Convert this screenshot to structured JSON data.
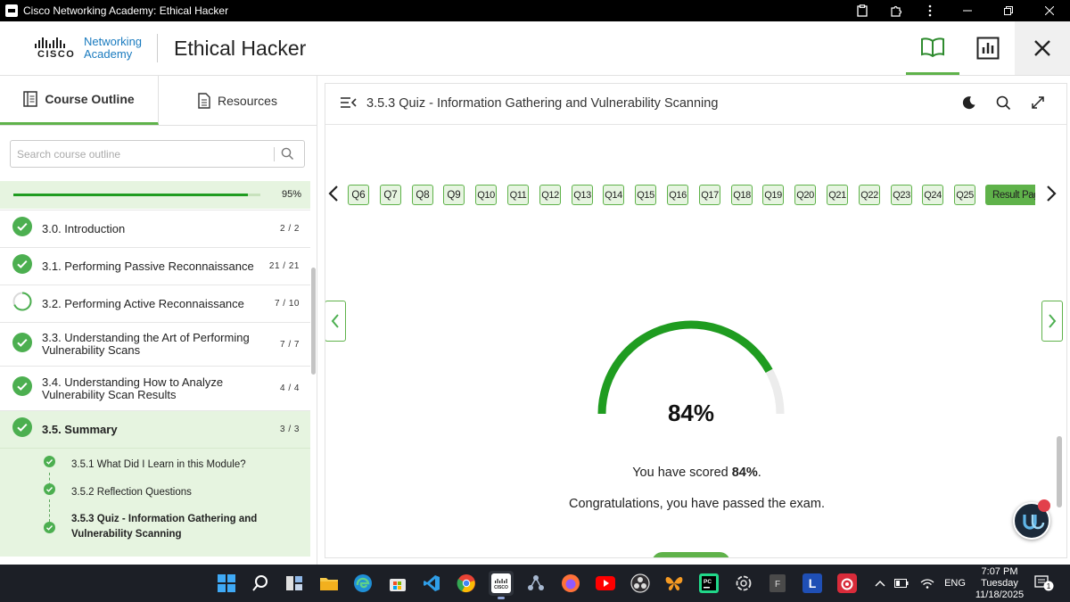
{
  "window": {
    "title": "Cisco Networking Academy: Ethical Hacker"
  },
  "header": {
    "logo_word": "CISCO",
    "logo_line1": "Networking",
    "logo_line2": "Academy",
    "course_title": "Ethical Hacker"
  },
  "sidebar": {
    "tabs": [
      {
        "label": "Course Outline",
        "icon": "outline-icon",
        "active": true
      },
      {
        "label": "Resources",
        "icon": "document-icon",
        "active": false
      }
    ],
    "search_placeholder": "Search course outline",
    "progress": {
      "percent_label": "95%",
      "percent": 95
    },
    "modules": [
      {
        "label": "3.0. Introduction",
        "count": "2 / 2",
        "status": "complete"
      },
      {
        "label": "3.1. Performing Passive Reconnaissance",
        "count": "21 / 21",
        "status": "complete"
      },
      {
        "label": "3.2. Performing Active Reconnaissance",
        "count": "7 / 10",
        "status": "in-progress"
      },
      {
        "label": "3.3. Understanding the Art of Performing Vulnerability Scans",
        "count": "7 / 7",
        "status": "complete"
      },
      {
        "label": "3.4. Understanding How to Analyze Vulnerability Scan Results",
        "count": "4 / 4",
        "status": "complete"
      },
      {
        "label": "3.5. Summary",
        "count": "3 / 3",
        "status": "complete",
        "current": true
      }
    ],
    "subitems": [
      {
        "label": "3.5.1 What Did I Learn in this Module?",
        "active": false
      },
      {
        "label": "3.5.2 Reflection Questions",
        "active": false
      },
      {
        "label": "3.5.3 Quiz - Information Gathering and Vulnerability Scanning",
        "active": true
      }
    ]
  },
  "main": {
    "quiz_title": "3.5.3 Quiz - Information Gathering and Vulnerability Scanning",
    "question_tabs": [
      "Q6",
      "Q7",
      "Q8",
      "Q9",
      "Q10",
      "Q11",
      "Q12",
      "Q13",
      "Q14",
      "Q15",
      "Q16",
      "Q17",
      "Q18",
      "Q19",
      "Q20",
      "Q21",
      "Q22",
      "Q23",
      "Q24",
      "Q25"
    ],
    "result_tab": "Result Page",
    "score": {
      "label": "84%",
      "percent": 84
    },
    "score_prefix": "You have scored ",
    "score_value": "84%",
    "score_suffix": ".",
    "congrats": "Congratulations, you have passed the exam."
  },
  "taskbar": {
    "language": "ENG",
    "time": "7:07 PM",
    "day": "Tuesday",
    "date": "11/18/2025",
    "notifications": "1"
  },
  "colors": {
    "accent": "#5fb24a",
    "progress": "#1f9c20",
    "light_green": "#e6f4e0"
  }
}
